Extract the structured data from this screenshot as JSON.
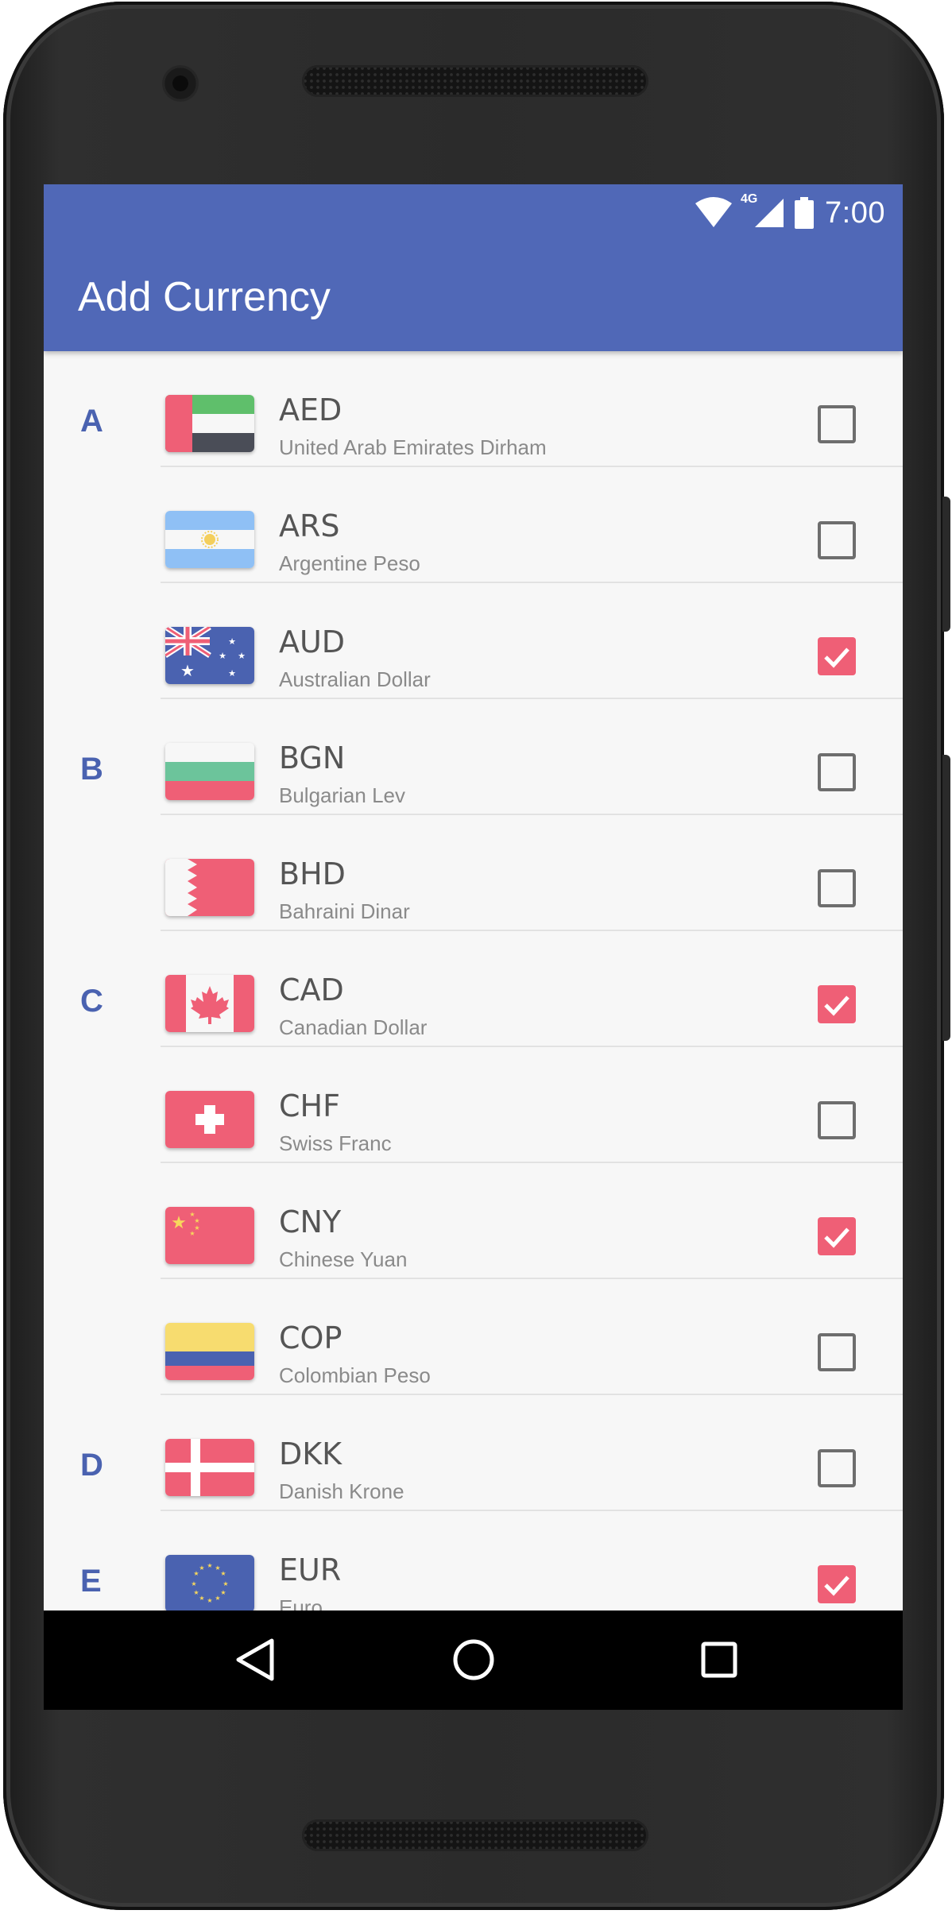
{
  "status_bar": {
    "network": "4G",
    "time": "7:00",
    "icons": [
      "wifi-icon",
      "cell-signal-icon",
      "battery-icon"
    ]
  },
  "app_bar": {
    "title": "Add Currency",
    "color": "#5068b7"
  },
  "currencies": [
    {
      "section": "A",
      "code": "AED",
      "name": "United Arab Emirates Dirham",
      "flag": "uae-flag-icon",
      "checked": false
    },
    {
      "section": "",
      "code": "ARS",
      "name": "Argentine Peso",
      "flag": "argentina-flag-icon",
      "checked": false
    },
    {
      "section": "",
      "code": "AUD",
      "name": "Australian Dollar",
      "flag": "australia-flag-icon",
      "checked": true
    },
    {
      "section": "B",
      "code": "BGN",
      "name": "Bulgarian Lev",
      "flag": "bulgaria-flag-icon",
      "checked": false
    },
    {
      "section": "",
      "code": "BHD",
      "name": "Bahraini Dinar",
      "flag": "bahrain-flag-icon",
      "checked": false
    },
    {
      "section": "C",
      "code": "CAD",
      "name": "Canadian Dollar",
      "flag": "canada-flag-icon",
      "checked": true
    },
    {
      "section": "",
      "code": "CHF",
      "name": "Swiss Franc",
      "flag": "switzerland-flag-icon",
      "checked": false
    },
    {
      "section": "",
      "code": "CNY",
      "name": "Chinese Yuan",
      "flag": "china-flag-icon",
      "checked": true
    },
    {
      "section": "",
      "code": "COP",
      "name": "Colombian Peso",
      "flag": "colombia-flag-icon",
      "checked": false
    },
    {
      "section": "D",
      "code": "DKK",
      "name": "Danish Krone",
      "flag": "denmark-flag-icon",
      "checked": false
    },
    {
      "section": "E",
      "code": "EUR",
      "name": "Euro",
      "flag": "eu-flag-icon",
      "checked": true
    }
  ],
  "colors": {
    "accent": "#ef5f76",
    "section_letter": "#4a62b0",
    "code_text": "#555555",
    "name_text": "#8a8a8a"
  },
  "nav_bar": {
    "buttons": [
      "back-icon",
      "home-icon",
      "recents-icon"
    ]
  }
}
